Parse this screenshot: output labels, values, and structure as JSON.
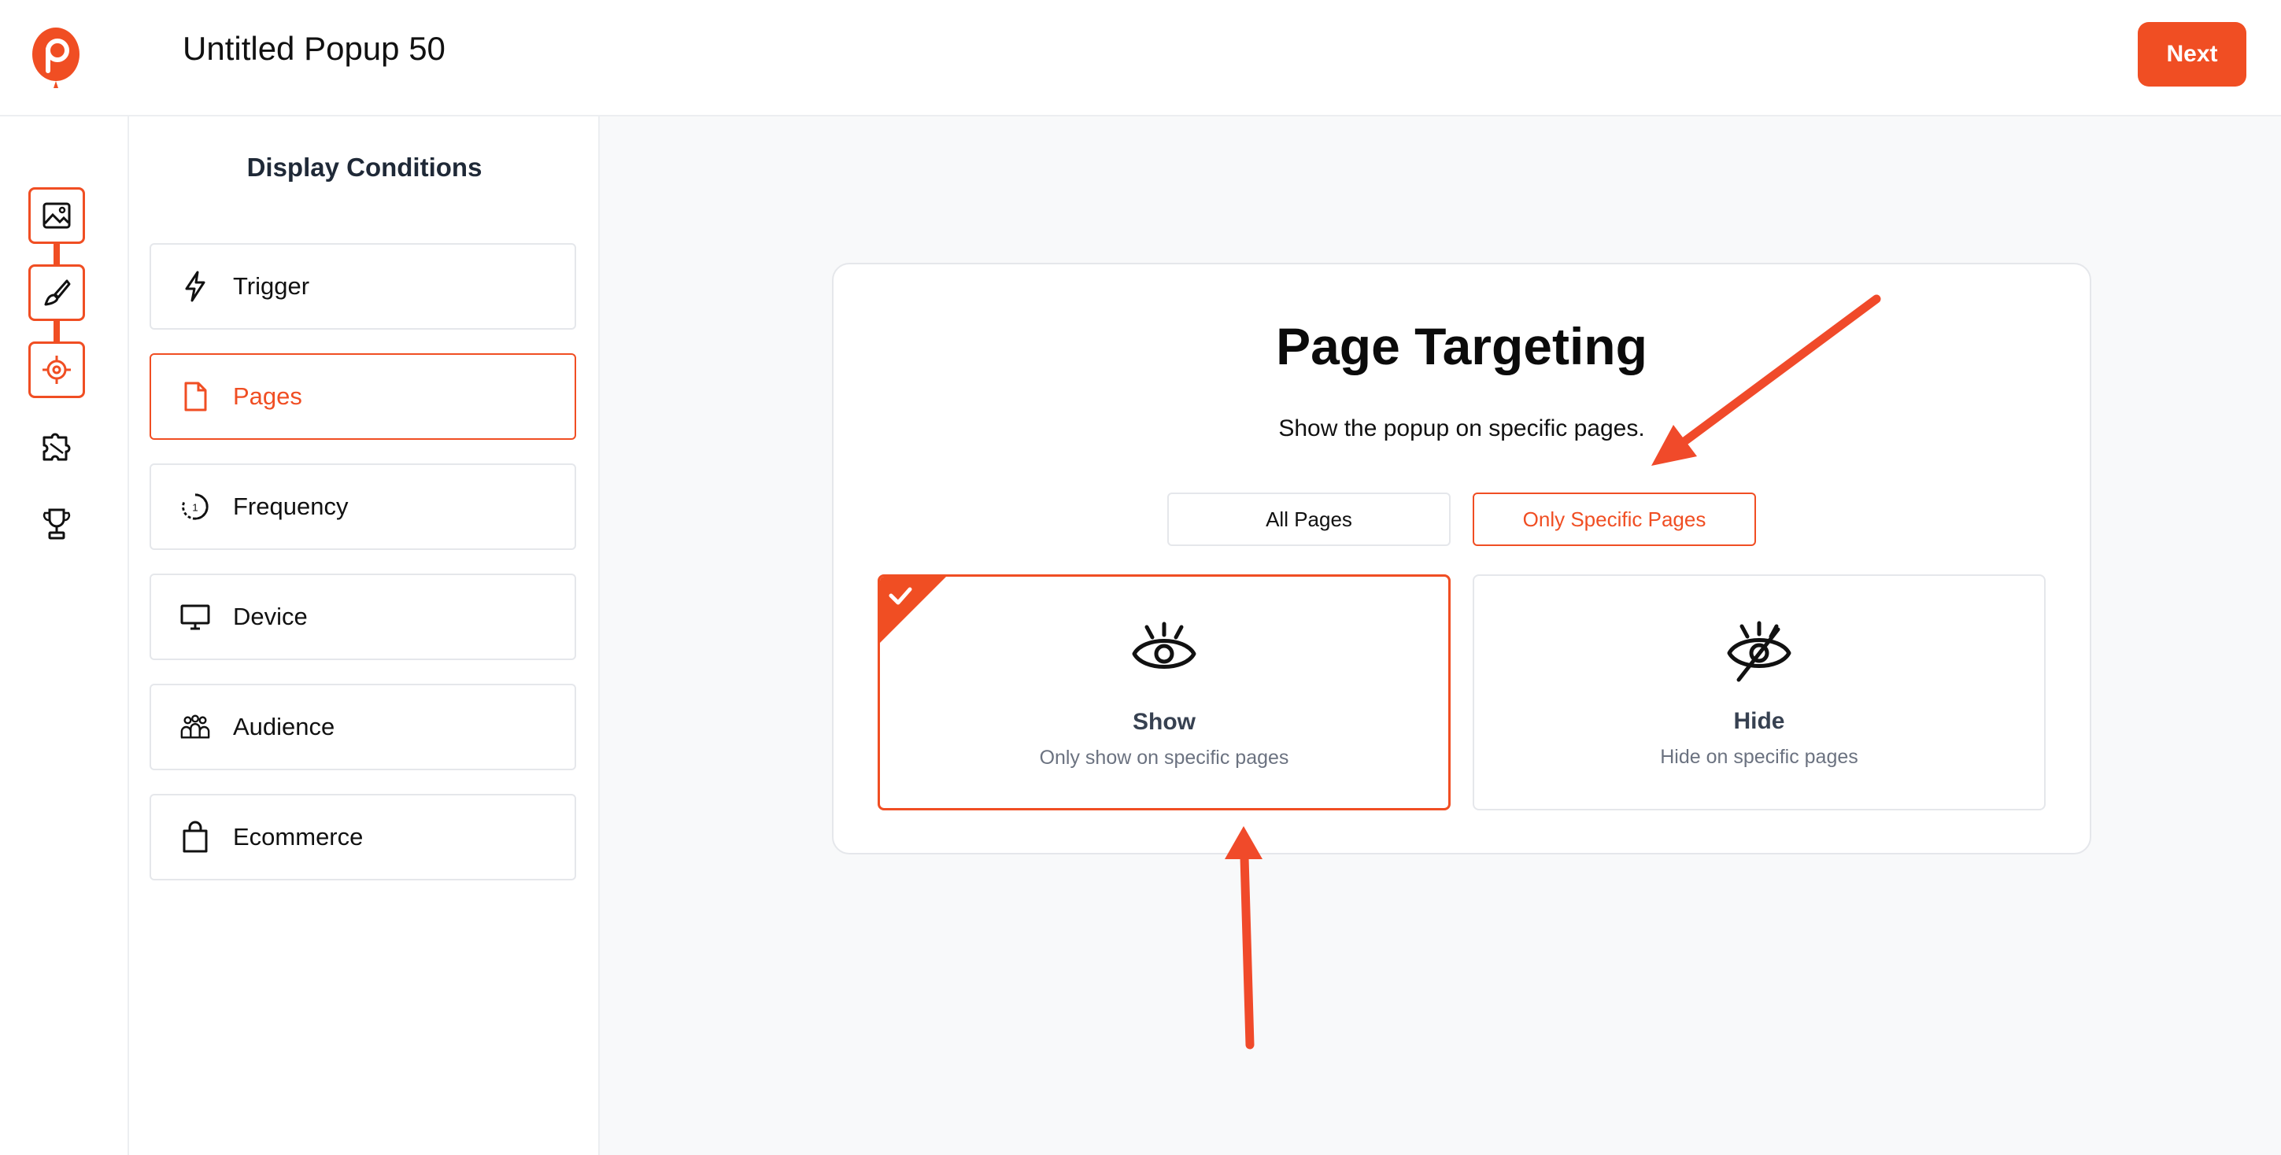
{
  "header": {
    "title": "Untitled Popup 50",
    "next_label": "Next"
  },
  "rail": {
    "steps": [
      "image-icon",
      "brush-icon",
      "target-icon"
    ],
    "extras": [
      "puzzle-icon",
      "trophy-icon"
    ]
  },
  "panel": {
    "title": "Display Conditions",
    "items": [
      {
        "label": "Trigger",
        "icon": "lightning-icon"
      },
      {
        "label": "Pages",
        "icon": "document-icon",
        "active": true
      },
      {
        "label": "Frequency",
        "icon": "timer-icon"
      },
      {
        "label": "Device",
        "icon": "monitor-icon"
      },
      {
        "label": "Audience",
        "icon": "people-icon"
      },
      {
        "label": "Ecommerce",
        "icon": "shopping-bag-icon"
      }
    ]
  },
  "targeting": {
    "title": "Page Targeting",
    "subtitle": "Show the popup on specific pages.",
    "segments": [
      {
        "label": "All Pages"
      },
      {
        "label": "Only Specific Pages",
        "active": true
      }
    ],
    "choices": [
      {
        "title": "Show",
        "description": "Only show on specific pages",
        "icon": "eye-icon",
        "selected": true
      },
      {
        "title": "Hide",
        "description": "Hide on specific pages",
        "icon": "eye-off-icon",
        "selected": false
      }
    ]
  },
  "colors": {
    "accent": "#f04e23",
    "border": "#e5e7eb",
    "background": "#f8f9fa"
  }
}
